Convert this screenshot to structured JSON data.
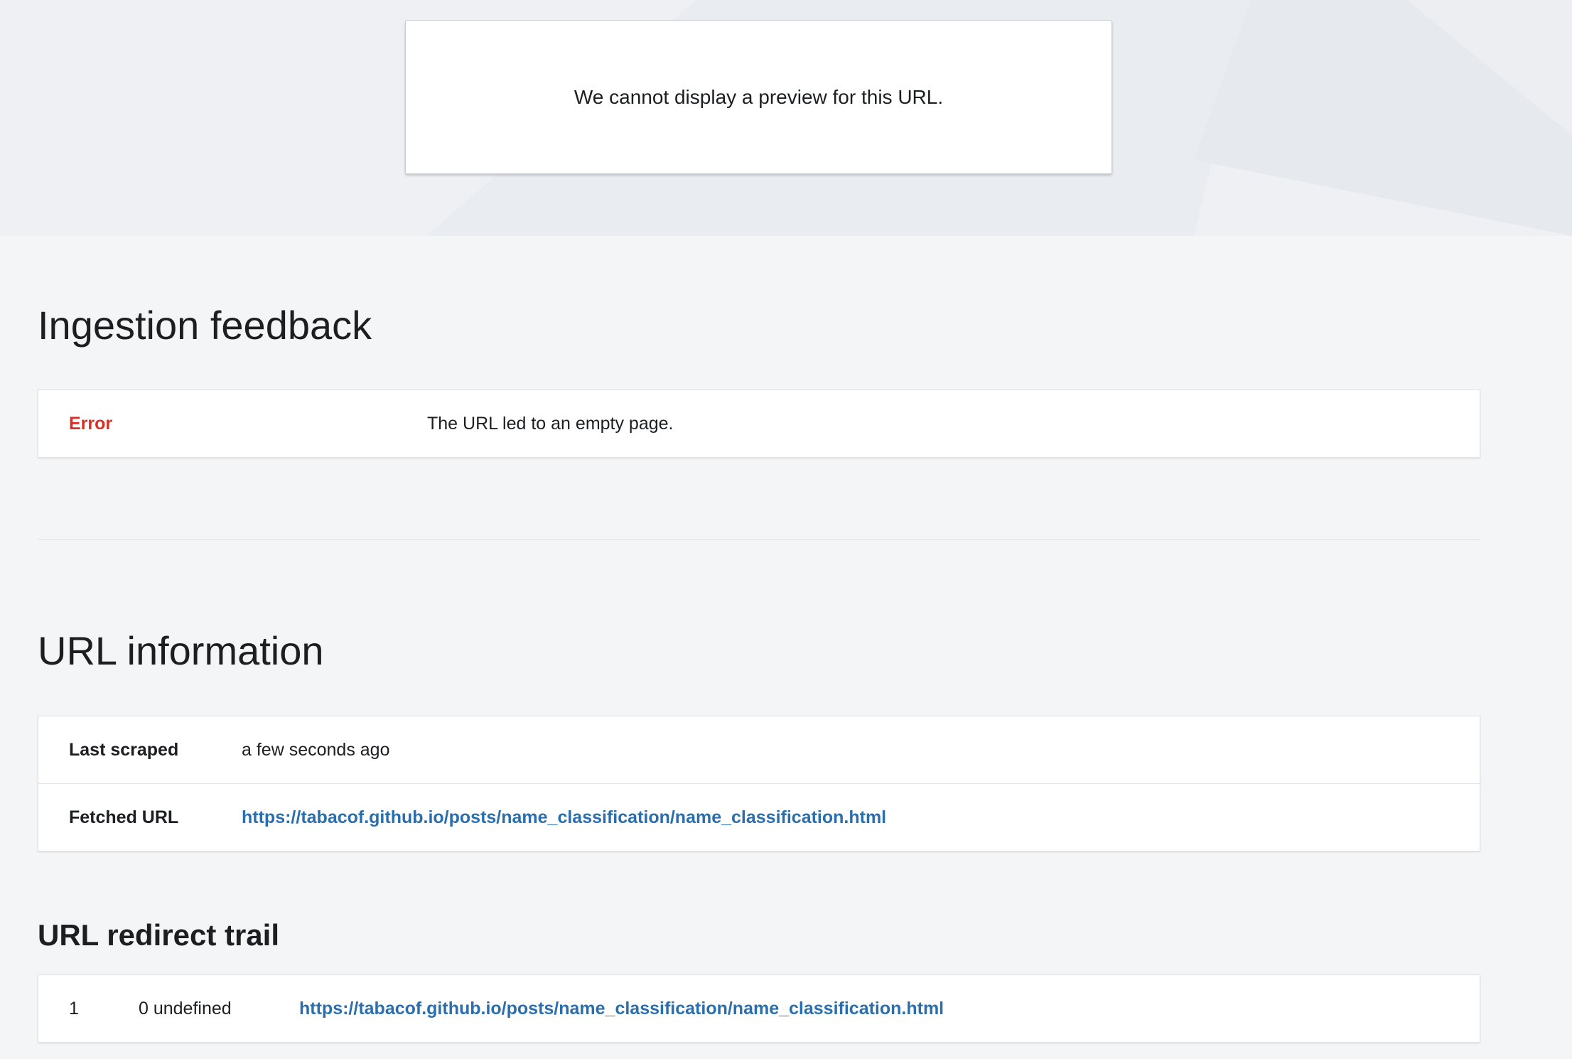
{
  "preview": {
    "message": "We cannot display a preview for this URL."
  },
  "ingestion": {
    "title": "Ingestion feedback",
    "rows": [
      {
        "label": "Error",
        "value": "The URL led to an empty page."
      }
    ]
  },
  "url_info": {
    "title": "URL information",
    "last_scraped_label": "Last scraped",
    "last_scraped_value": "a few seconds ago",
    "fetched_url_label": "Fetched URL",
    "fetched_url_value": "https://tabacof.github.io/posts/name_classification/name_classification.html"
  },
  "redirect_trail": {
    "title": "URL redirect trail",
    "rows": [
      {
        "index": "1",
        "status": "0 undefined",
        "url": "https://tabacof.github.io/posts/name_classification/name_classification.html"
      }
    ]
  },
  "colors": {
    "error": "#d93025",
    "link": "#2a6ead"
  }
}
